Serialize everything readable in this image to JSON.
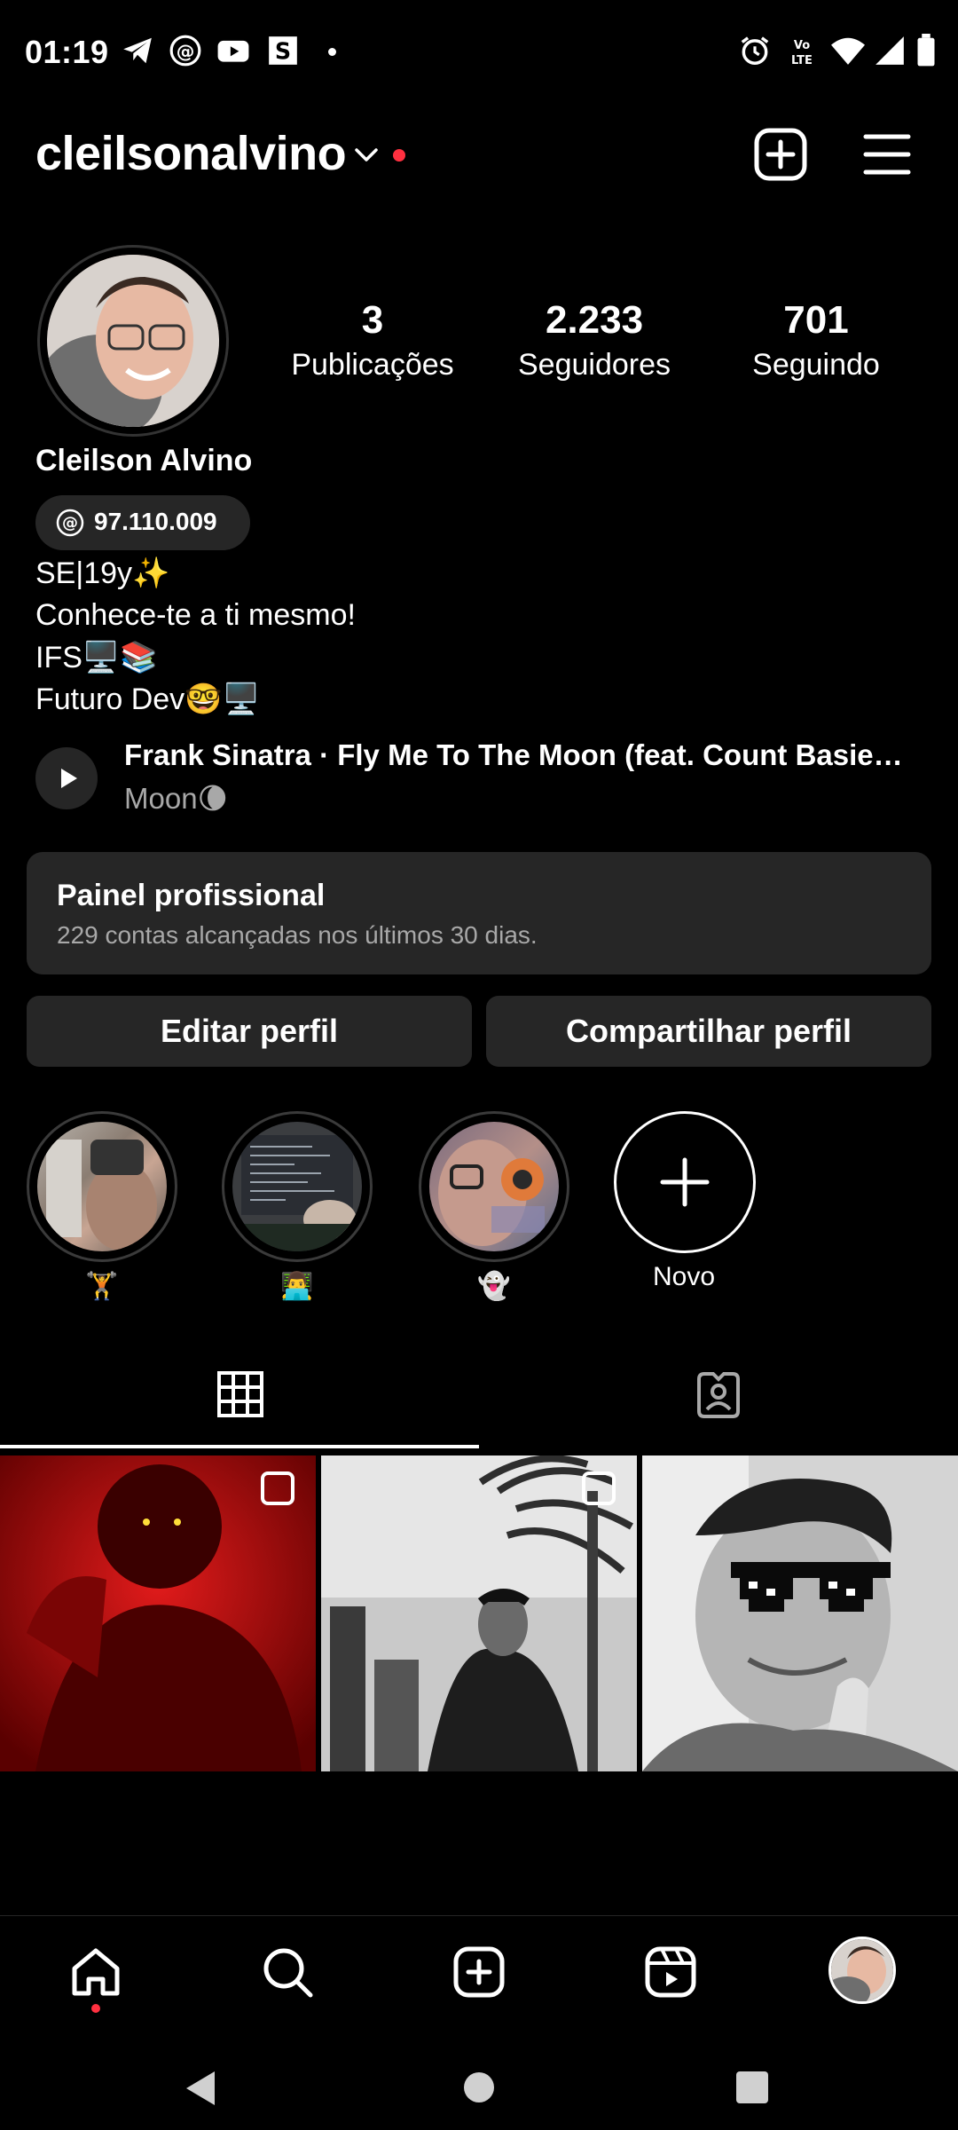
{
  "status_bar": {
    "time": "01:19",
    "left_icons": [
      "telegram-icon",
      "threads-icon",
      "youtube-icon",
      "s-app-icon",
      "dot-icon"
    ],
    "right_icons": [
      "alarm-icon",
      "volte-icon",
      "wifi-icon",
      "signal-icon",
      "battery-icon"
    ],
    "volte_label": "Vo LTE"
  },
  "header": {
    "username": "cleilsonalvino",
    "accent_dot_color": "#ff3040"
  },
  "profile": {
    "stats": [
      {
        "value": "3",
        "label": "Publicações"
      },
      {
        "value": "2.233",
        "label": "Seguidores"
      },
      {
        "value": "701",
        "label": "Seguindo"
      }
    ],
    "display_name": "Cleilson Alvino",
    "threads_count": "97.110.009",
    "bio": [
      "SE|19y✨",
      "Conhece-te a ti mesmo!",
      "IFS🖥️📚",
      "Futuro Dev🤓🖥️"
    ],
    "music": {
      "title": "Frank Sinatra · Fly Me To The Moon (feat. Count Basie…",
      "subtitle": "Moon🌘"
    }
  },
  "professional_panel": {
    "title": "Painel profissional",
    "subtitle": "229 contas alcançadas nos últimos 30 dias."
  },
  "actions": {
    "edit": "Editar perfil",
    "share": "Compartilhar perfil"
  },
  "highlights": [
    {
      "label": "🏋️"
    },
    {
      "label": "👨‍💻"
    },
    {
      "label": "👻"
    }
  ],
  "new_highlight_label": "Novo",
  "tabs": [
    "grid-icon",
    "tagged-icon"
  ],
  "posts": [
    "red-selfie",
    "bw-palm-tree",
    "bw-sunglasses"
  ],
  "bottom_nav": [
    "home-icon",
    "search-icon",
    "create-icon",
    "reels-icon",
    "profile-avatar"
  ]
}
